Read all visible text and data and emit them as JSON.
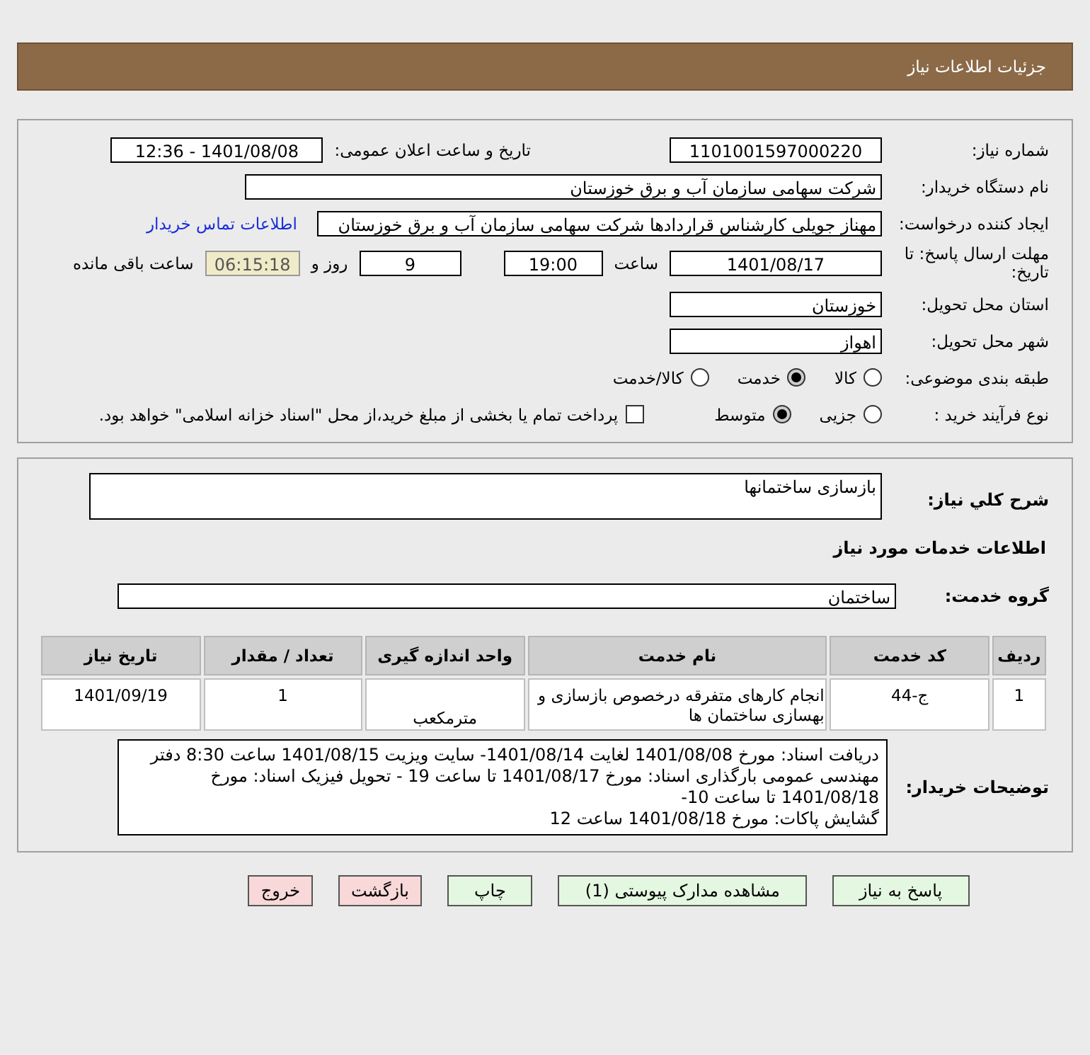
{
  "header": {
    "title": "جزئیات اطلاعات نیاز"
  },
  "details": {
    "need_number": {
      "label": "شماره نیاز:",
      "value": "1101001597000220"
    },
    "announce": {
      "label": "تاریخ و ساعت اعلان عمومی:",
      "value": "1401/08/08 - 12:36"
    },
    "buyer": {
      "label": "نام دستگاه خریدار:",
      "value": "شرکت سهامی سازمان آب و برق خوزستان"
    },
    "creator": {
      "label": "ایجاد کننده درخواست:",
      "value": "مهناز جویلی کارشناس قراردادها شرکت سهامی سازمان آب و برق خوزستان",
      "link": "اطلاعات تماس خریدار"
    },
    "deadline": {
      "label": "مهلت ارسال پاسخ: تا تاریخ:",
      "date": "1401/08/17",
      "time_label": "ساعت",
      "time": "19:00",
      "days": "9",
      "days_label": "روز و",
      "remaining": "06:15:18",
      "remaining_label": "ساعت باقی مانده"
    },
    "province": {
      "label": "استان محل تحویل:",
      "value": "خوزستان"
    },
    "city": {
      "label": "شهر محل تحویل:",
      "value": "اهواز"
    },
    "category": {
      "label": "طبقه بندی موضوعی:",
      "options": [
        {
          "label": "کالا",
          "selected": false
        },
        {
          "label": "خدمت",
          "selected": true
        },
        {
          "label": "کالا/خدمت",
          "selected": false
        }
      ]
    },
    "process": {
      "label": "نوع فرآیند خرید :",
      "options": [
        {
          "label": "جزیی",
          "selected": false
        },
        {
          "label": "متوسط",
          "selected": true
        }
      ],
      "payment": {
        "label": "پرداخت تمام یا بخشی از مبلغ خرید،از محل \"اسناد خزانه اسلامی\" خواهد بود.",
        "checked": false
      }
    }
  },
  "need": {
    "summary_label": "شرح کلي نياز:",
    "summary": "بازسازی ساختمانها",
    "services_heading": "اطلاعات خدمات مورد نياز",
    "group_label": "گروه خدمت:",
    "group": "ساختمان",
    "table": {
      "columns": [
        "ردیف",
        "کد خدمت",
        "نام خدمت",
        "واحد اندازه گیری",
        "تعداد / مقدار",
        "تاریخ نیاز"
      ],
      "rows": [
        [
          "1",
          "ج-44",
          "انجام کارهای متفرقه درخصوص بازسازی و بهسازی ساختمان ها",
          "مترمکعب",
          "1",
          "1401/09/19"
        ]
      ]
    },
    "notes_label": "توضیحات خریدار:",
    "notes": [
      "دریافت اسناد: مورخ 1401/08/08 لغایت 1401/08/14- سایت ویزیت 1401/08/15 ساعت 8:30 دفتر مهندسی عمومی بارگذاری اسناد: مورخ 1401/08/17 تا ساعت 19 - تحویل فیزیک اسناد: مورخ 1401/08/18 تا ساعت 10-",
      "گشایش پاکات: مورخ 1401/08/18 ساعت 12"
    ]
  },
  "buttons": [
    {
      "label": "پاسخ به نیاز",
      "kind": "primary"
    },
    {
      "label": "مشاهده مدارک پیوستی (1)",
      "kind": "primary"
    },
    {
      "label": "چاپ",
      "kind": "primary"
    },
    {
      "label": "بازگشت",
      "kind": "exit"
    },
    {
      "label": "خروج",
      "kind": "exit"
    }
  ]
}
